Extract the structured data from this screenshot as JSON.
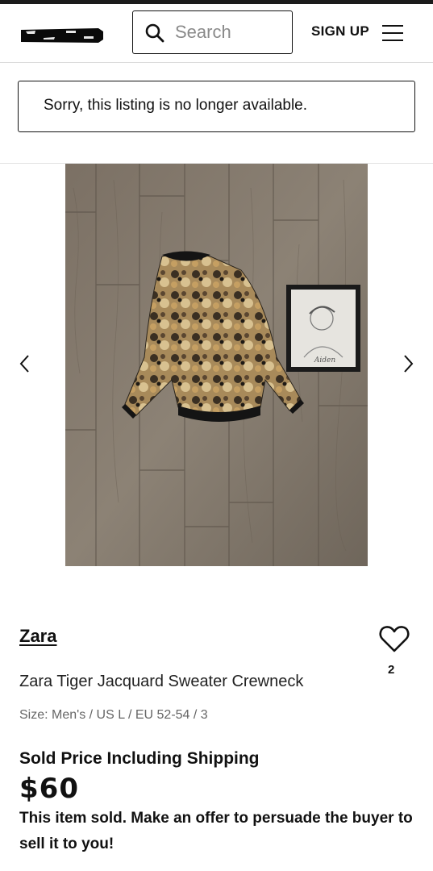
{
  "header": {
    "search_placeholder": "Search",
    "signup_label": "SIGN UP",
    "icons": [
      "logo",
      "search-icon",
      "menu-icon"
    ]
  },
  "notice": {
    "message": "Sorry, this listing is no longer available."
  },
  "gallery": {
    "icons": [
      "chevron-left-icon",
      "chevron-right-icon"
    ],
    "signature": "Aiden"
  },
  "listing": {
    "designer": "Zara",
    "favorites_count": "2",
    "title": "Zara Tiger Jacquard Sweater Crewneck",
    "size": "Size: Men's / US L / EU 52-54 / 3",
    "sold_price_label": "Sold Price Including Shipping",
    "price": "$60",
    "sold_note": "This item sold. Make an offer to persuade the buyer to sell it to you!"
  },
  "colors": {
    "text": "#111111",
    "border": "#111111",
    "floor": "#8a7f72"
  }
}
